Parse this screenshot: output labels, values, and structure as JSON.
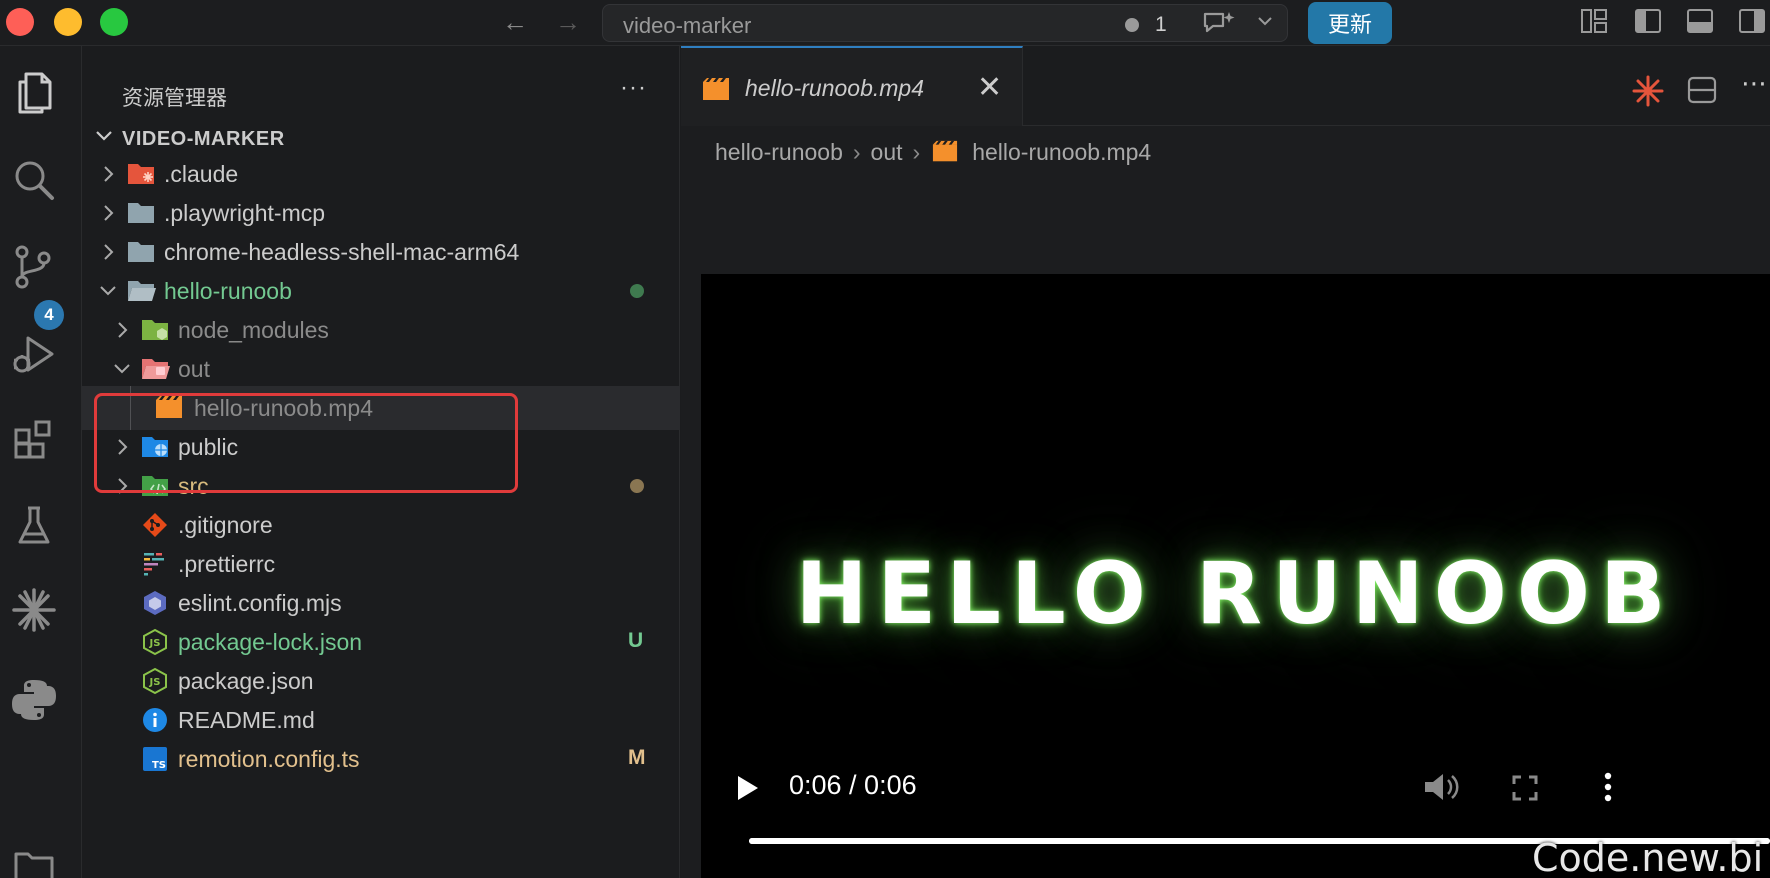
{
  "titlebar": {
    "search_text": "video-marker",
    "problems_count": "1",
    "update_label": "更新"
  },
  "activity_bar": {
    "items": [
      "explorer-icon",
      "search-icon",
      "source-control-icon",
      "run-debug-icon",
      "extensions-icon",
      "testing-icon",
      "claude-icon",
      "python-icon",
      "folder-icon"
    ],
    "scm_badge": "4"
  },
  "sidebar": {
    "title": "资源管理器",
    "more": "···",
    "root": "VIDEO-MARKER",
    "tree": [
      {
        "name": ".claude",
        "status": "",
        "color": "#cccccc"
      },
      {
        "name": ".playwright-mcp",
        "status": "",
        "color": "#cccccc"
      },
      {
        "name": "chrome-headless-shell-mac-arm64",
        "status": "",
        "color": "#cccccc"
      },
      {
        "name": "hello-runoob",
        "status": "dot",
        "color": "#73c991"
      },
      {
        "name": "node_modules",
        "status": "",
        "color": "#8b8b8b"
      },
      {
        "name": "out",
        "status": "",
        "color": "#8b8b8b"
      },
      {
        "name": "hello-runoob.mp4",
        "status": "",
        "color": "#8b8b8b"
      },
      {
        "name": "public",
        "status": "",
        "color": "#cccccc"
      },
      {
        "name": "src",
        "status": "dot",
        "color": "#d7ba7d"
      },
      {
        "name": ".gitignore",
        "status": "",
        "color": "#cccccc"
      },
      {
        "name": ".prettierrc",
        "status": "",
        "color": "#cccccc"
      },
      {
        "name": "eslint.config.mjs",
        "status": "",
        "color": "#cccccc"
      },
      {
        "name": "package-lock.json",
        "status": "U",
        "color": "#73c991"
      },
      {
        "name": "package.json",
        "status": "",
        "color": "#cccccc"
      },
      {
        "name": "README.md",
        "status": "",
        "color": "#cccccc"
      },
      {
        "name": "remotion.config.ts",
        "status": "M",
        "color": "#e2c08d"
      }
    ]
  },
  "editor": {
    "tab_label": "hello-runoob.mp4",
    "breadcrumb": [
      "hello-runoob",
      "out",
      "hello-runoob.mp4"
    ],
    "video_text": "HELLO RUNOOB",
    "time": "0:06 / 0:06",
    "progress_fraction": 1.0
  },
  "watermark": "Code.new.bi",
  "colors": {
    "accent": "#2f7fc1",
    "update_button": "#2378a8",
    "highlight_box": "#e03b3b",
    "untracked": "#73c991",
    "modified": "#e2c08d"
  }
}
